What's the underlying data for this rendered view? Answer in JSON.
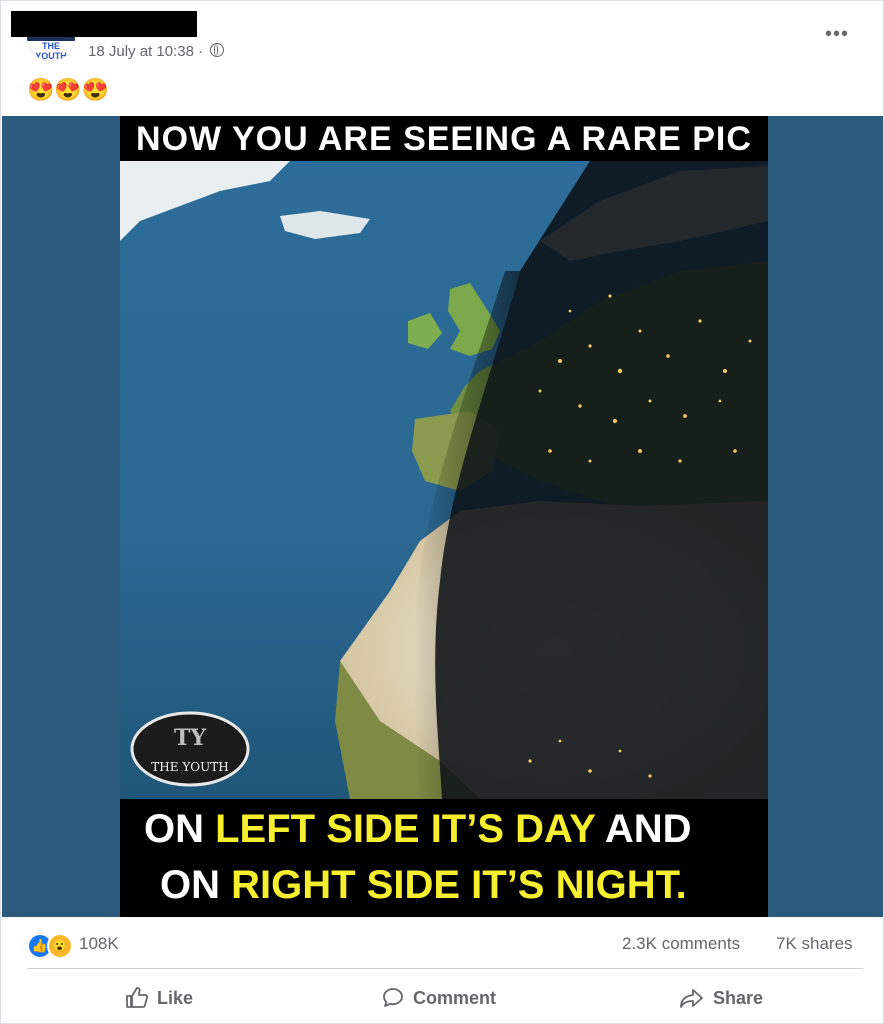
{
  "post": {
    "timestamp": "18 July at 10:38 ·",
    "avatar_text": "THE YOUTH",
    "caption": "😍😍😍",
    "more": "•••"
  },
  "image": {
    "top_text": "NOW YOU ARE SEEING A RARE PIC",
    "line1": {
      "a": "ON ",
      "b": "LEFT SIDE IT’S DAY",
      "c": " AND"
    },
    "line2": {
      "a": "ON ",
      "b": "RIGHT SIDE IT’S NIGHT."
    },
    "watermark": "THE YOUTH",
    "watermark_mono": "TY"
  },
  "stats": {
    "reactions_count": "108K",
    "comments": "2.3K comments",
    "shares": "7K shares"
  },
  "actions": {
    "like": "Like",
    "comment": "Comment",
    "share": "Share"
  },
  "colors": {
    "accent_yellow": "#f6ef2f",
    "like_blue": "#1877f2",
    "media_bg": "#2c5a7c"
  },
  "icons": [
    "globe-icon",
    "more-icon",
    "like-reaction-icon",
    "wow-reaction-icon",
    "like-icon",
    "comment-icon",
    "share-icon"
  ]
}
